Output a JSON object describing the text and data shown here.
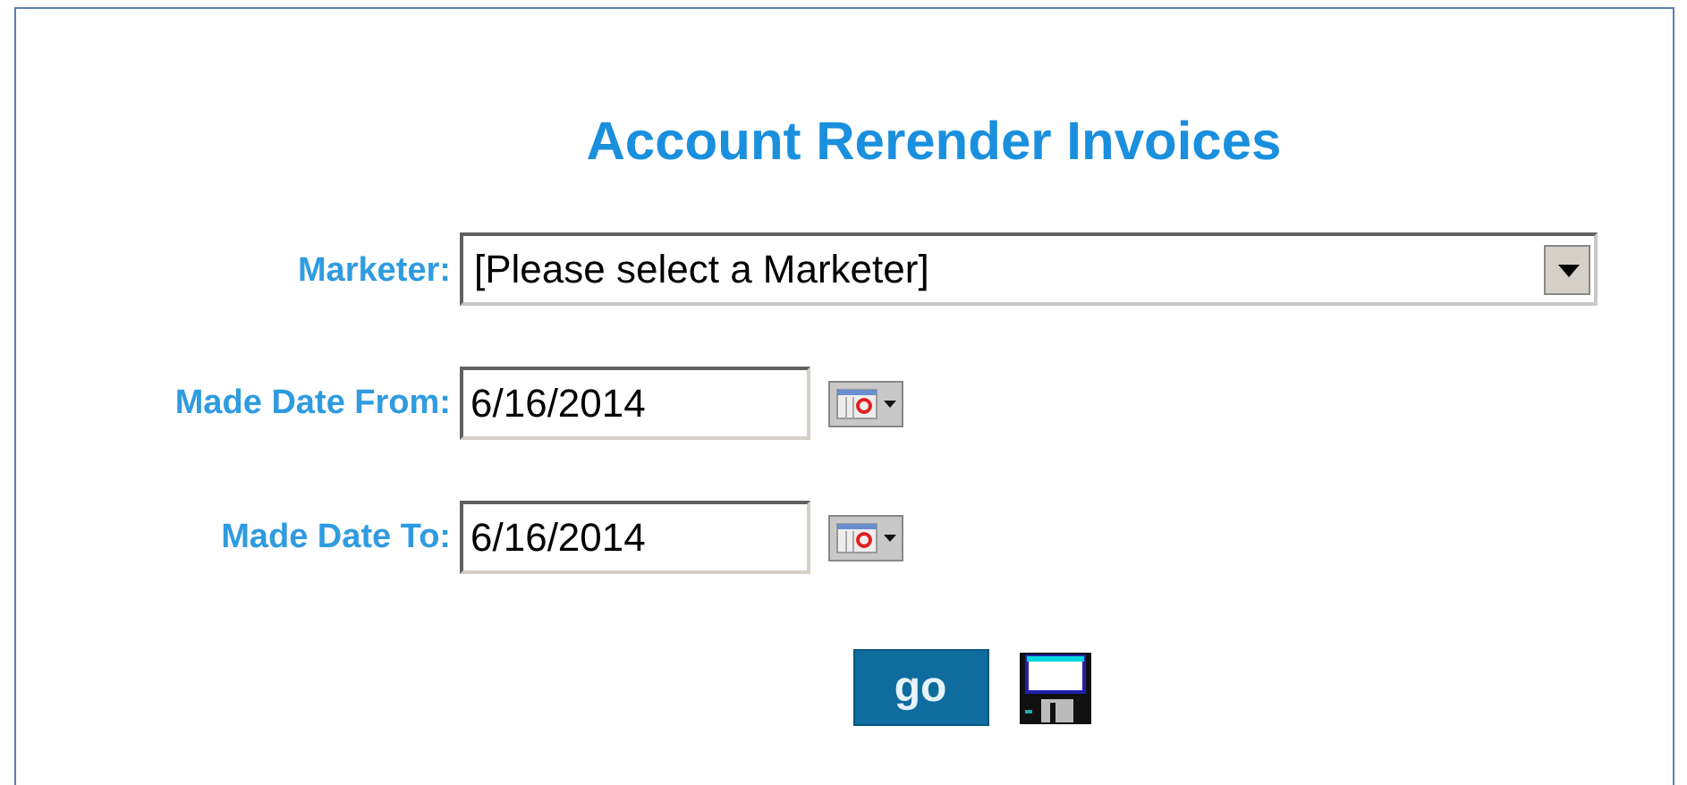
{
  "title": "Account Rerender Invoices",
  "marketer": {
    "label": "Marketer:",
    "value": "[Please select a Marketer]"
  },
  "date_fields": [
    {
      "label": "Made Date From:",
      "value": "6/16/2014"
    },
    {
      "label": "Made Date To:",
      "value": "6/16/2014"
    }
  ],
  "buttons": [
    {
      "kind": "go",
      "label": "go"
    },
    {
      "kind": "save"
    }
  ]
}
